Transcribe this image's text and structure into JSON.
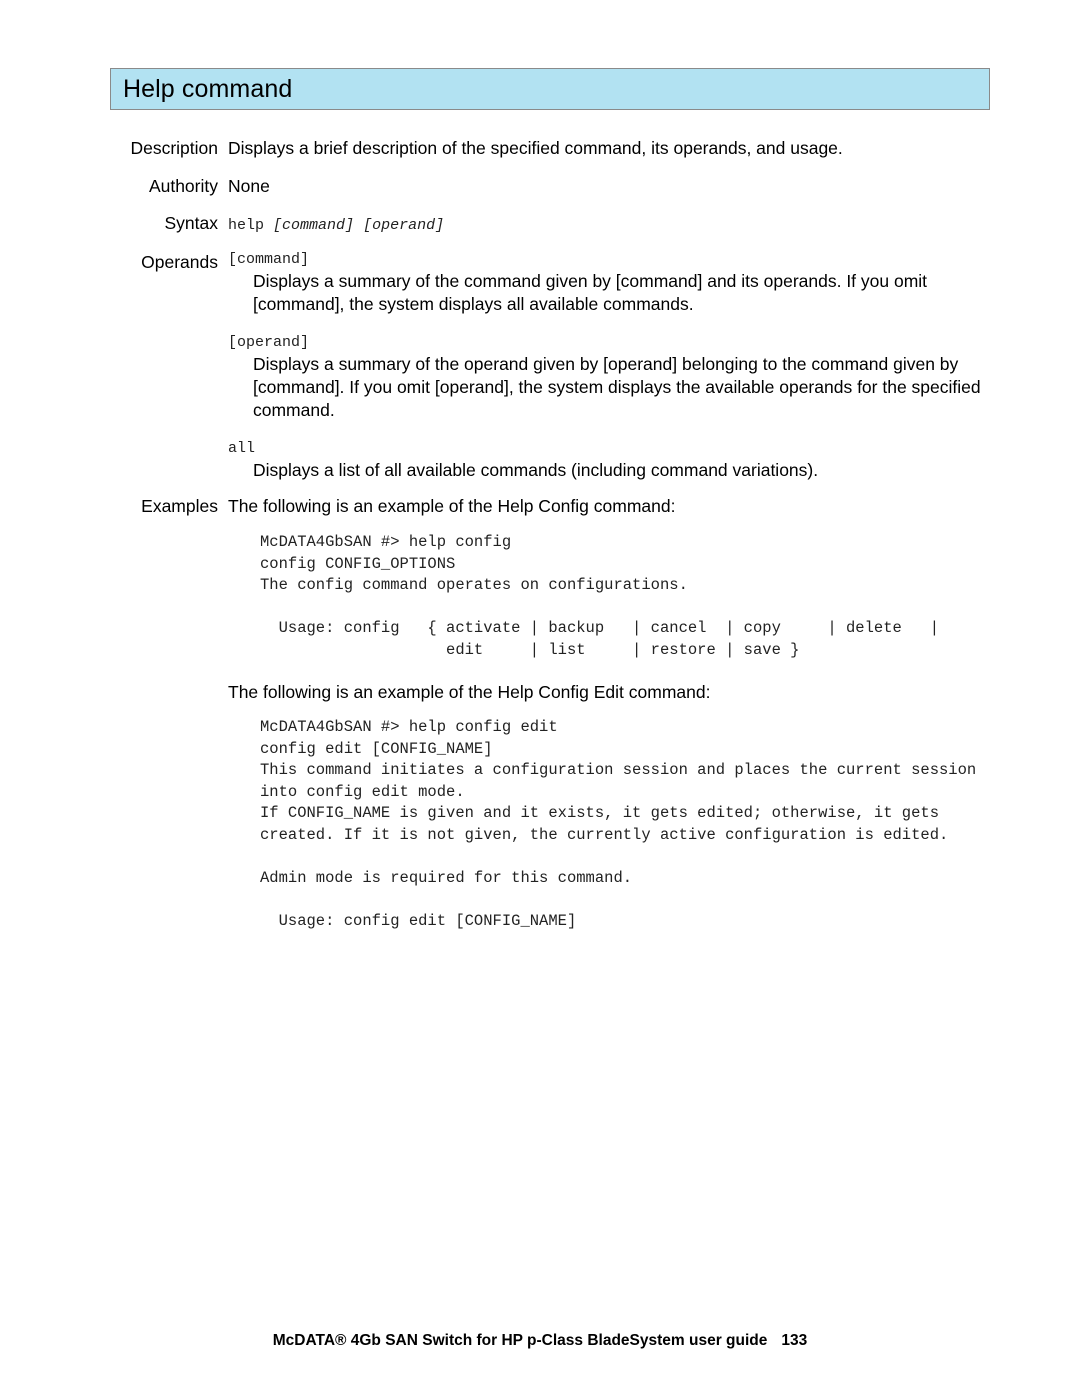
{
  "header": {
    "title": "Help command",
    "bar_fill": "#b2e2f2",
    "bar_border": "#8a8a8a"
  },
  "sections": {
    "description": {
      "label": "Description",
      "text": "Displays a brief description of the specified command, its operands, and usage."
    },
    "authority": {
      "label": "Authority",
      "text": "None"
    },
    "syntax": {
      "label": "Syntax",
      "command": "help",
      "arg1": "[command]",
      "arg2": "[operand]"
    },
    "operands": {
      "label": "Operands",
      "items": [
        {
          "term": "[command]",
          "definition": "Displays a summary of the command given by [command] and its operands. If you omit [command], the system displays all available commands."
        },
        {
          "term": "[operand]",
          "definition": "Displays a summary of the operand given by [operand] belonging to the command given by [command]. If you omit [operand], the system displays the available operands for the specified command."
        },
        {
          "term": "all",
          "definition": "Displays a list of all available commands (including command variations)."
        }
      ]
    },
    "examples": {
      "label": "Examples",
      "intro_1": "The following is an example of the Help Config command:",
      "code_1": "McDATA4GbSAN #> help config\nconfig CONFIG_OPTIONS\nThe config command operates on configurations.\n\n  Usage: config   { activate | backup   | cancel  | copy     | delete   |\n                    edit     | list     | restore | save }",
      "intro_2": "The following is an example of the Help Config Edit command:",
      "code_2": "McDATA4GbSAN #> help config edit\nconfig edit [CONFIG_NAME]\nThis command initiates a configuration session and places the current session\ninto config edit mode.\nIf CONFIG_NAME is given and it exists, it gets edited; otherwise, it gets\ncreated. If it is not given, the currently active configuration is edited.\n\nAdmin mode is required for this command.\n\n  Usage: config edit [CONFIG_NAME]"
    }
  },
  "footer": {
    "title": "McDATA® 4Gb SAN Switch for HP p-Class BladeSystem user guide",
    "page_number": "133"
  }
}
